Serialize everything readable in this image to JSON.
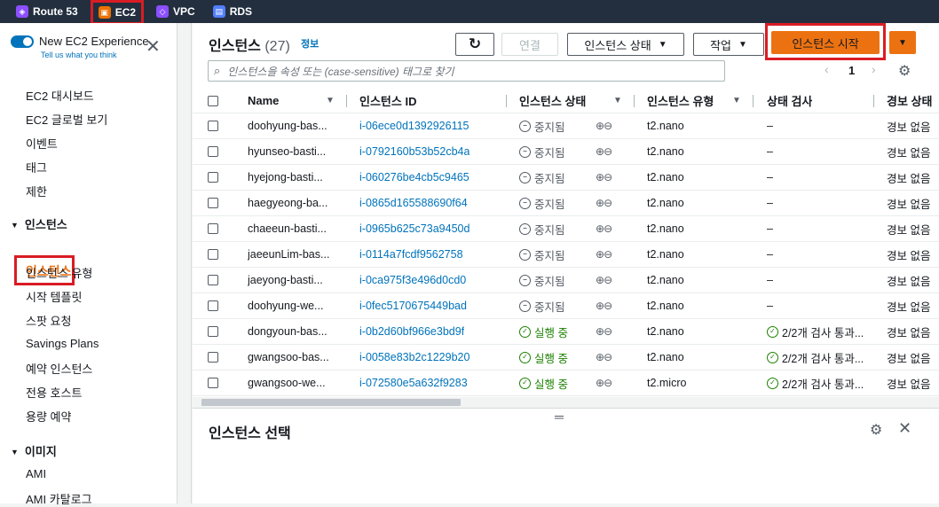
{
  "topbar": {
    "services": [
      {
        "label": "Route 53",
        "icon": "route53-icon",
        "color": "#8c4fff"
      },
      {
        "label": "EC2",
        "icon": "ec2-icon",
        "color": "#ed7100"
      },
      {
        "label": "VPC",
        "icon": "vpc-icon",
        "color": "#8c4fff"
      },
      {
        "label": "RDS",
        "icon": "rds-icon",
        "color": "#527fff"
      }
    ]
  },
  "sidebar": {
    "new_experience": "New EC2 Experience",
    "tell_us": "Tell us what you think",
    "items": [
      "EC2 대시보드",
      "EC2 글로벌 보기",
      "이벤트",
      "태그",
      "제한"
    ],
    "section_instances": "인스턴스",
    "instance_items": [
      "인스턴스",
      "인스턴스 유형",
      "시작 템플릿",
      "스팟 요청",
      "Savings Plans",
      "예약 인스턴스",
      "전용 호스트",
      "용량 예약"
    ],
    "section_images": "이미지",
    "image_items": [
      "AMI",
      "AMI 카탈로그"
    ]
  },
  "main": {
    "title": "인스턴스",
    "count": "(27)",
    "info": "정보",
    "connect": "연결",
    "instance_state": "인스턴스 상태",
    "actions": "작업",
    "launch": "인스턴스 시작",
    "search_placeholder": "인스턴스을 속성 또는 (case-sensitive) 태그로 찾기",
    "page": "1",
    "columns": {
      "name": "Name",
      "id": "인스턴스 ID",
      "state": "인스턴스 상태",
      "type": "인스턴스 유형",
      "check": "상태 검사",
      "alarm": "경보 상태"
    },
    "rows": [
      {
        "name": "doohyung-bas...",
        "id": "i-06ece0d1392926115",
        "state": "중지됨",
        "running": false,
        "type": "t2.nano",
        "check": "–",
        "alarm": "경보 없음"
      },
      {
        "name": "hyunseo-basti...",
        "id": "i-0792160b53b52cb4a",
        "state": "중지됨",
        "running": false,
        "type": "t2.nano",
        "check": "–",
        "alarm": "경보 없음"
      },
      {
        "name": "hyejong-basti...",
        "id": "i-060276be4cb5c9465",
        "state": "중지됨",
        "running": false,
        "type": "t2.nano",
        "check": "–",
        "alarm": "경보 없음"
      },
      {
        "name": "haegyeong-ba...",
        "id": "i-0865d165588690f64",
        "state": "중지됨",
        "running": false,
        "type": "t2.nano",
        "check": "–",
        "alarm": "경보 없음"
      },
      {
        "name": "chaeeun-basti...",
        "id": "i-0965b625c73a9450d",
        "state": "중지됨",
        "running": false,
        "type": "t2.nano",
        "check": "–",
        "alarm": "경보 없음"
      },
      {
        "name": "jaeeunLim-bas...",
        "id": "i-0114a7fcdf9562758",
        "state": "중지됨",
        "running": false,
        "type": "t2.nano",
        "check": "–",
        "alarm": "경보 없음"
      },
      {
        "name": "jaeyong-basti...",
        "id": "i-0ca975f3e496d0cd0",
        "state": "중지됨",
        "running": false,
        "type": "t2.nano",
        "check": "–",
        "alarm": "경보 없음"
      },
      {
        "name": "doohyung-we...",
        "id": "i-0fec5170675449bad",
        "state": "중지됨",
        "running": false,
        "type": "t2.nano",
        "check": "–",
        "alarm": "경보 없음"
      },
      {
        "name": "dongyoun-bas...",
        "id": "i-0b2d60bf966e3bd9f",
        "state": "실행 중",
        "running": true,
        "type": "t2.nano",
        "check": "2/2개 검사 통과...",
        "alarm": "경보 없음"
      },
      {
        "name": "gwangsoo-bas...",
        "id": "i-0058e83b2c1229b20",
        "state": "실행 중",
        "running": true,
        "type": "t2.nano",
        "check": "2/2개 검사 통과...",
        "alarm": "경보 없음"
      },
      {
        "name": "gwangsoo-we...",
        "id": "i-072580e5a632f9283",
        "state": "실행 중",
        "running": true,
        "type": "t2.micro",
        "check": "2/2개 검사 통과...",
        "alarm": "경보 없음"
      }
    ],
    "selection_title": "인스턴스 선택"
  }
}
